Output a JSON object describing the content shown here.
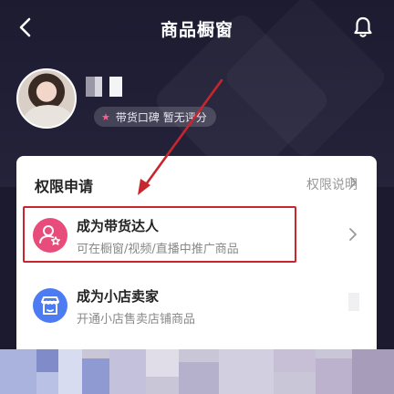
{
  "nav": {
    "title": "商品橱窗"
  },
  "profile": {
    "badge": "带货口碑 暂无评分"
  },
  "permissions": {
    "title": "权限申请",
    "help_link": "权限说明",
    "items": [
      {
        "title": "成为带货达人",
        "subtitle": "可在橱窗/视频/直播中推广商品"
      },
      {
        "title": "成为小店卖家",
        "subtitle": "开通小店售卖店铺商品"
      }
    ]
  },
  "colors": {
    "background": "#1c1a2e",
    "accent_pink": "#e84c7a",
    "accent_blue": "#4d7cf2",
    "highlight_border": "#c8262e"
  },
  "icons": [
    "back-icon",
    "bell-icon",
    "star-icon",
    "user-star-icon",
    "shop-icon",
    "chevron-right-icon"
  ]
}
